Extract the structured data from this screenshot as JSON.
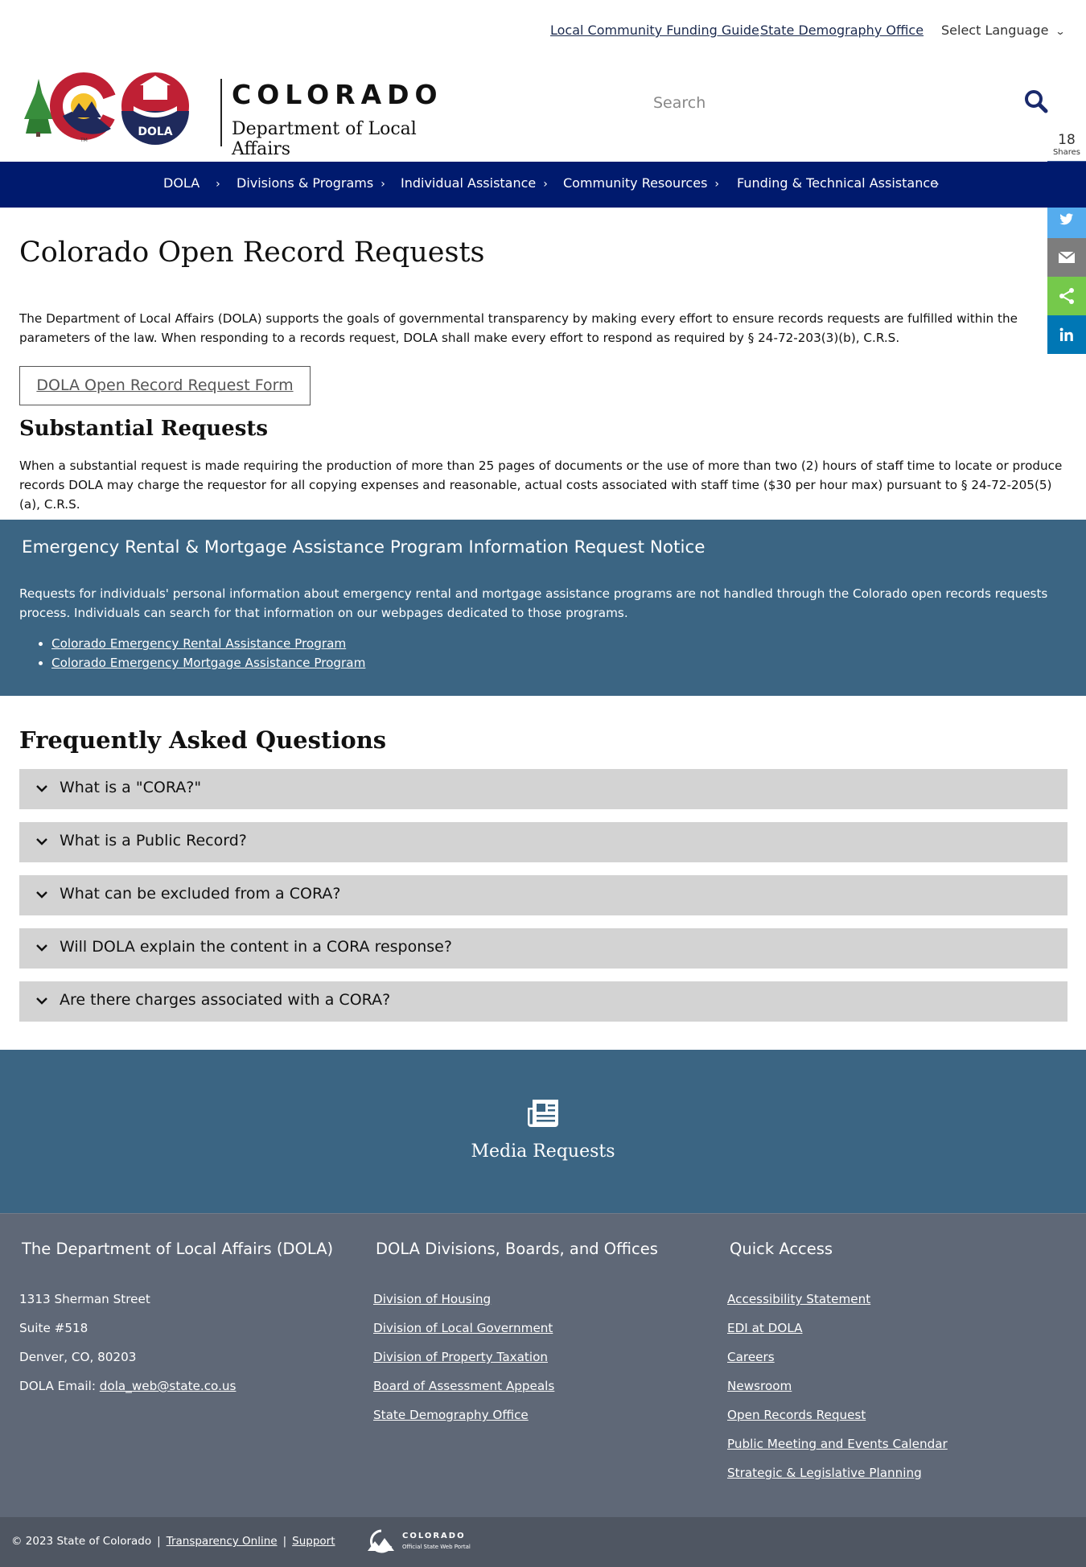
{
  "utility": {
    "links": [
      "Local Community Funding Guide",
      "State Demography Office"
    ],
    "language": "Select Language"
  },
  "header": {
    "logo_word": "COLORADO",
    "logo_sub": "Department of Local Affairs",
    "logo_badge": "DOLA",
    "search_placeholder": "Search"
  },
  "share": {
    "count": "18",
    "label": "Shares",
    "buttons": [
      {
        "name": "facebook",
        "color": "#3b5998"
      },
      {
        "name": "twitter",
        "color": "#55acee"
      },
      {
        "name": "email",
        "color": "#7d7d7d"
      },
      {
        "name": "share",
        "color": "#75c94b"
      },
      {
        "name": "linkedin",
        "color": "#0077b5"
      }
    ]
  },
  "nav": {
    "items": [
      "DOLA",
      "Divisions & Programs",
      "Individual Assistance",
      "Community Resources",
      "Funding & Technical Assistance"
    ]
  },
  "main": {
    "title": "Colorado Open Record Requests",
    "intro": "The Department of Local Affairs (DOLA) supports the goals of governmental transparency by making every effort to ensure records requests are fulfilled within the parameters of the law. When responding to a records request, DOLA shall make every effort to respond as required by § 24-72-203(3)(b), C.R.S.",
    "form_button": "DOLA Open Record Request Form",
    "substantial_title": "Substantial Requests",
    "substantial_text": "When a substantial request is made requiring the production of more than 25 pages of documents or the use of more than two (2) hours of staff time to locate or produce records DOLA may charge the requestor for all copying expenses and reasonable, actual costs associated with staff time ($30 per hour max) pursuant to § 24-72-205(5)(a), C.R.S."
  },
  "notice": {
    "title": "Emergency Rental & Mortgage Assistance Program Information Request Notice",
    "text": "Requests for individuals' personal information about emergency rental and mortgage assistance programs are not handled through the Colorado open records requests process. Individuals can search for that information on our webpages dedicated to those programs.",
    "links": [
      "Colorado Emergency Rental Assistance Program",
      "Colorado Emergency Mortgage Assistance Program"
    ]
  },
  "faq": {
    "title": "Frequently Asked Questions",
    "items": [
      "What is a \"CORA?\"",
      "What is a Public Record?",
      "What can be excluded from a CORA?",
      "Will DOLA explain the content in a CORA response?",
      "Are there charges associated with a CORA?"
    ]
  },
  "media": {
    "label": "Media Requests"
  },
  "footer": {
    "col1": {
      "title": "The Department of Local Affairs (DOLA)",
      "address1": "1313 Sherman Street",
      "address2": "Suite  #518",
      "address3": "Denver, CO, 80203",
      "email_label": "DOLA Email: ",
      "email": "dola_web@state.co.us"
    },
    "col2": {
      "title": "DOLA Divisions, Boards, and Offices",
      "links": [
        "Division of Housing",
        "Division of Local Government",
        "Division of Property Taxation",
        "Board of Assessment Appeals",
        "State Demography Office"
      ]
    },
    "col3": {
      "title": "Quick Access",
      "links": [
        "Accessibility Statement",
        "EDI at DOLA",
        "Careers",
        "Newsroom",
        "Open Records Request",
        "Public Meeting and Events Calendar",
        "Strategic & Legislative Planning"
      ]
    }
  },
  "bottom": {
    "copyright": "© 2023 State of Colorado",
    "transparency": "Transparency Online",
    "support": "Support",
    "sep": "|",
    "portal_word": "COLORADO",
    "portal_sub": "Official State Web Portal"
  },
  "colors": {
    "nav_bg": "#001a6e",
    "band_bg": "#3b6583",
    "footer_bg": "#5f6877",
    "bottom_bg": "#4f5662",
    "faq_bg": "#d3d3d3"
  }
}
